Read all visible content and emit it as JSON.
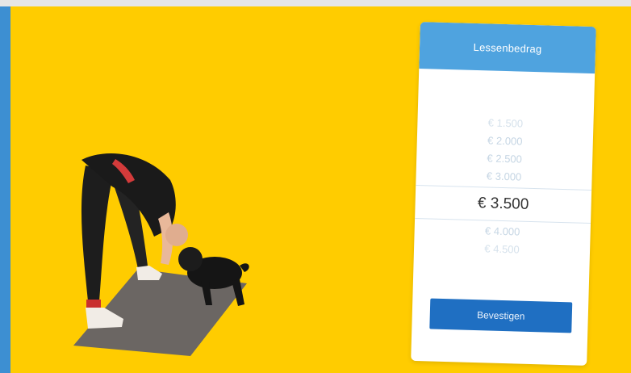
{
  "card": {
    "title": "Lessenbedrag",
    "options": [
      "€ 1.500",
      "€ 2.000",
      "€ 2.500",
      "€ 3.000",
      "€ 3.500",
      "€ 4.000",
      "€ 4.500"
    ],
    "selected": "€ 3.500",
    "confirm_label": "Bevestigen"
  },
  "colors": {
    "stage": "#ffcc00",
    "accent": "#4fa3df",
    "button": "#1f6fc2",
    "leftbar": "#3d8fd2"
  }
}
